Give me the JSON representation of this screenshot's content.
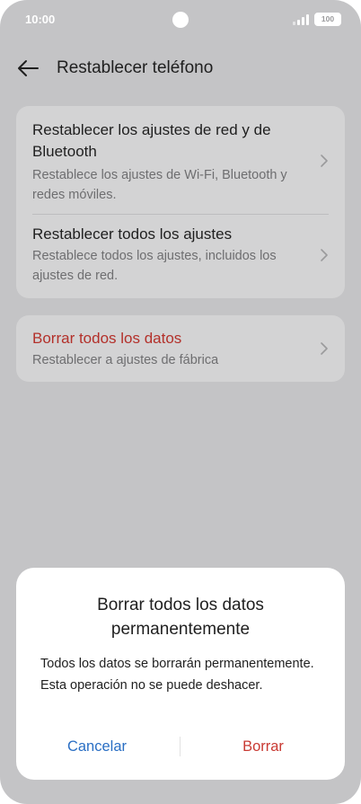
{
  "status_bar": {
    "time": "10:00",
    "battery": "100"
  },
  "header": {
    "title": "Restablecer teléfono"
  },
  "options": {
    "network_reset": {
      "title": "Restablecer los ajustes de red y de Bluetooth",
      "subtitle": "Restablece los ajustes de Wi-Fi, Bluetooth y redes móviles."
    },
    "all_settings_reset": {
      "title": "Restablecer todos los ajustes",
      "subtitle": "Restablece todos los ajustes, incluidos los ajustes de red."
    },
    "erase_all": {
      "title": "Borrar todos los datos",
      "subtitle": "Restablecer a ajustes de fábrica"
    }
  },
  "dialog": {
    "title": "Borrar todos los datos permanentemente",
    "message": "Todos los datos se borrarán permanentemente. Esta operación no se puede deshacer.",
    "cancel_label": "Cancelar",
    "confirm_label": "Borrar"
  },
  "colors": {
    "danger": "#b3302a",
    "link": "#2a6fc4",
    "overlay": "#c4c4c6"
  }
}
